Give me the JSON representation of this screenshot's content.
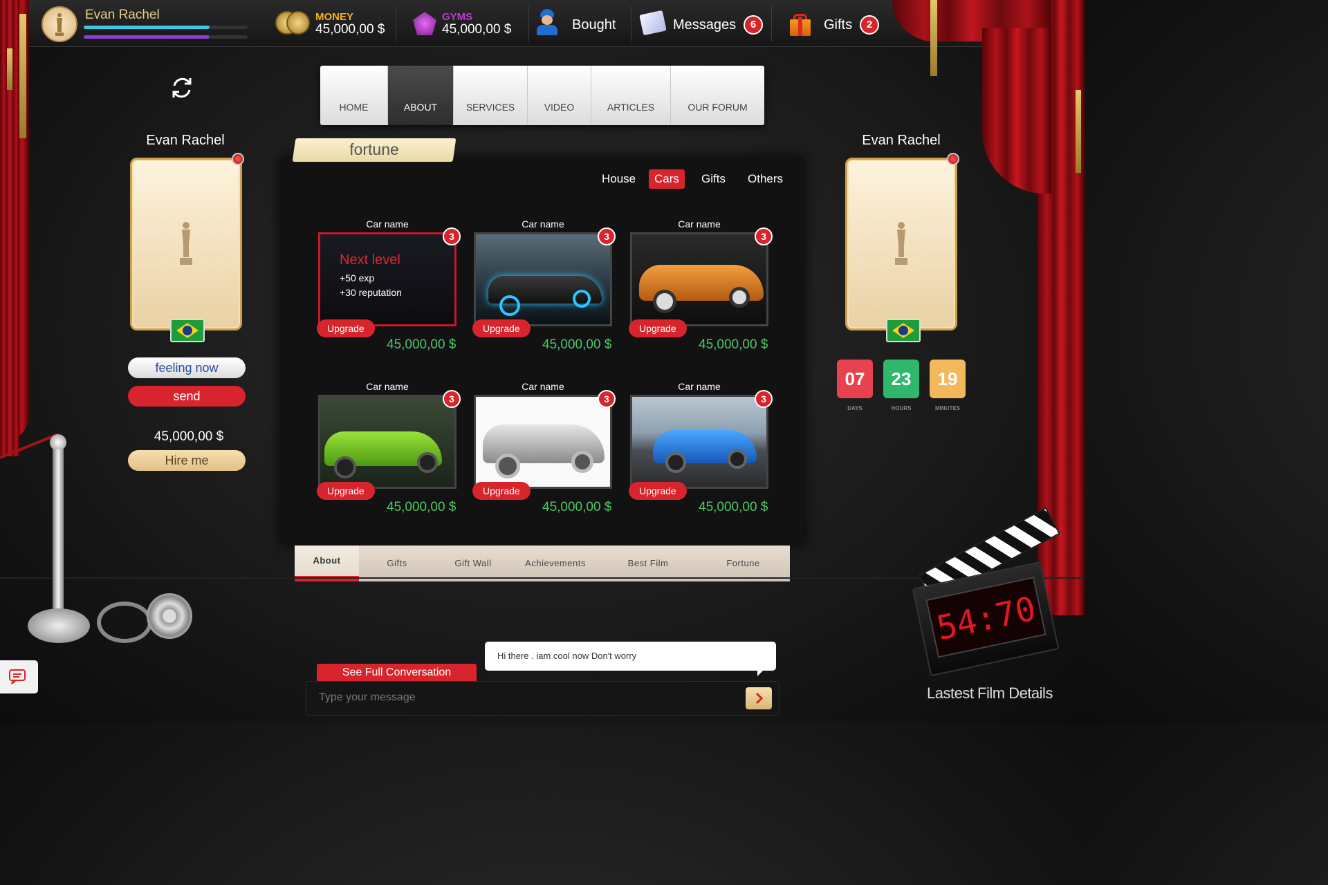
{
  "user": {
    "name": "Evan Rachel"
  },
  "stats": {
    "money_label": "MONEY",
    "money_value": "45,000,00 $",
    "gyms_label": "GYMS",
    "gyms_value": "45,000,00 $",
    "bought_label": "Bought",
    "messages_label": "Messages",
    "messages_count": "6",
    "gifts_label": "Gifts",
    "gifts_count": "2"
  },
  "nav": {
    "items": [
      "HOME",
      "ABOUT",
      "SERVICES",
      "VIDEO",
      "ARTICLES",
      "OUR FORUM"
    ],
    "active": "ABOUT"
  },
  "fortune": {
    "tab_label": "fortune"
  },
  "categories": {
    "items": [
      "House",
      "Cars",
      "Gifts",
      "Others"
    ],
    "active": "Cars"
  },
  "cars": [
    {
      "name": "Car name",
      "badge": "3",
      "upgrade": "Upgrade",
      "price": "45,000,00 $",
      "overlay_title": "Next level",
      "overlay_line1": "+50 exp",
      "overlay_line2": "+30 reputation"
    },
    {
      "name": "Car name",
      "badge": "3",
      "upgrade": "Upgrade",
      "price": "45,000,00 $"
    },
    {
      "name": "Car name",
      "badge": "3",
      "upgrade": "Upgrade",
      "price": "45,000,00 $"
    },
    {
      "name": "Car name",
      "badge": "3",
      "upgrade": "Upgrade",
      "price": "45,000,00 $"
    },
    {
      "name": "Car name",
      "badge": "3",
      "upgrade": "Upgrade",
      "price": "45,000,00 $"
    },
    {
      "name": "Car name",
      "badge": "3",
      "upgrade": "Upgrade",
      "price": "45,000,00 $"
    }
  ],
  "bottom_tabs": {
    "items": [
      "About",
      "Gifts",
      "Gift Wall",
      "Achievements",
      "Best Film",
      "Fortune"
    ],
    "active": "About"
  },
  "left_profile": {
    "name": "Evan Rachel",
    "feeling_label": "feeling now",
    "send_label": "send",
    "price": "45,000,00 $",
    "hire_label": "Hire me"
  },
  "right_profile": {
    "name": "Evan Rachel"
  },
  "countdown": {
    "days": "07",
    "days_label": "DAYS",
    "hours": "23",
    "hours_label": "HOURS",
    "minutes": "19",
    "minutes_label": "MINUTES"
  },
  "chat": {
    "see_full_label": "See Full Conversation",
    "bubble_text": "Hi there . iam cool now Don't worry",
    "input_placeholder": "Type your message"
  },
  "clapper": {
    "timer": "54:70"
  },
  "footer": {
    "latest_film_label": "Lastest Film Details"
  },
  "colors": {
    "accent_red": "#d8242c",
    "price_green": "#4cc964",
    "days_box": "#e8414f",
    "hours_box": "#2fb86b",
    "minutes_box": "#f3b75c",
    "gyms_purple": "#c03ad6",
    "money_gold": "#f2b21b"
  }
}
